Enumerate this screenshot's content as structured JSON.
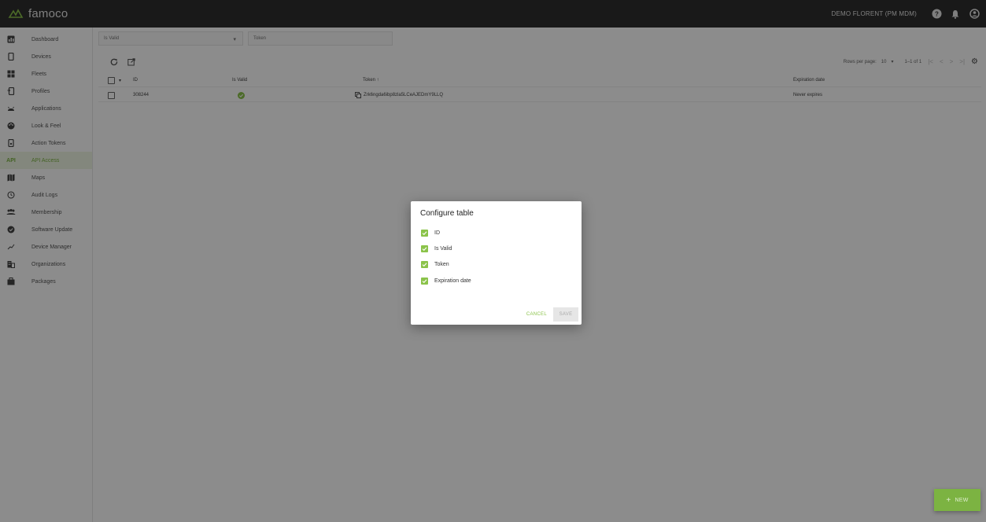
{
  "app": {
    "brand": "famoco",
    "user": "DEMO FLORENT (PM MDM)"
  },
  "colors": {
    "accent": "#8bc34a",
    "topbar": "#2f2f2f"
  },
  "sidebar": {
    "items": [
      {
        "label": "Dashboard",
        "icon": "dashboard-icon"
      },
      {
        "label": "Devices",
        "icon": "device-icon"
      },
      {
        "label": "Fleets",
        "icon": "fleets-icon"
      },
      {
        "label": "Profiles",
        "icon": "profiles-icon"
      },
      {
        "label": "Applications",
        "icon": "android-icon"
      },
      {
        "label": "Look & Feel",
        "icon": "palette-icon"
      },
      {
        "label": "Action Tokens",
        "icon": "token-icon"
      },
      {
        "label": "API Access",
        "icon": "api-icon",
        "badge": "API"
      },
      {
        "label": "Maps",
        "icon": "map-icon"
      },
      {
        "label": "Audit Logs",
        "icon": "history-icon"
      },
      {
        "label": "Membership",
        "icon": "group-icon"
      },
      {
        "label": "Software Update",
        "icon": "shield-icon"
      },
      {
        "label": "Device Manager",
        "icon": "device-manager-icon"
      },
      {
        "label": "Organizations",
        "icon": "organization-icon"
      },
      {
        "label": "Packages",
        "icon": "package-icon"
      }
    ]
  },
  "filters": {
    "is_valid": "Is Valid",
    "token_placeholder": "Token"
  },
  "pagination": {
    "rows_label": "Rows per page:",
    "rows_value": "10",
    "range": "1–1 of 1"
  },
  "table": {
    "columns": [
      "ID",
      "Is Valid",
      "Token ↑",
      "Expiration date"
    ],
    "rows": [
      {
        "id": "308244",
        "token": "Zrk6ngda6ibp8zla5LCeAJEDmY9LLQ",
        "expiration": "Never expires"
      }
    ]
  },
  "dialog": {
    "title": "Configure table",
    "options": [
      "ID",
      "Is Valid",
      "Token",
      "Expiration date"
    ],
    "cancel": "CANCEL",
    "save": "SAVE"
  },
  "fab": {
    "label": "NEW"
  }
}
